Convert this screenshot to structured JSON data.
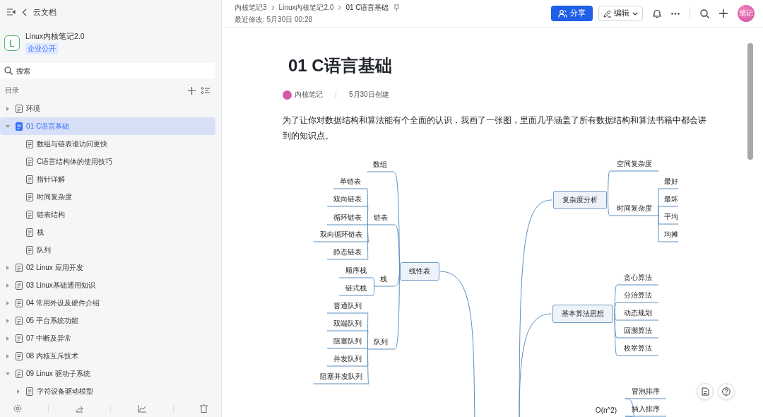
{
  "sidebar": {
    "back_label": "云文档",
    "space": {
      "name": "Linux内核笔记2.0",
      "tag": "企业公开",
      "logo": "L"
    },
    "search": {
      "placeholder": "搜索"
    },
    "toc_label": "目录",
    "items": [
      {
        "label": "环境",
        "expanded": false,
        "selected": false
      },
      {
        "label": "01 C语言基础",
        "expanded": true,
        "selected": true,
        "children": [
          {
            "label": "数组与链表谁访问更快",
            "selected": false
          },
          {
            "label": "C语言结构体的使用技巧",
            "selected": false
          },
          {
            "label": "指针详解",
            "selected": false
          },
          {
            "label": "时间复杂度",
            "selected": false
          },
          {
            "label": "链表结构",
            "selected": false
          },
          {
            "label": "栈",
            "selected": false
          },
          {
            "label": "队列",
            "selected": false
          }
        ]
      },
      {
        "label": "02 Linux 应用开发",
        "expanded": false,
        "selected": false
      },
      {
        "label": "03 Linux基础通用知识",
        "expanded": false,
        "selected": false
      },
      {
        "label": "04 常用外设及硬件介绍",
        "expanded": false,
        "selected": false
      },
      {
        "label": "05 平台系统功能",
        "expanded": false,
        "selected": false
      },
      {
        "label": "07 中断及异常",
        "expanded": false,
        "selected": false
      },
      {
        "label": "08 内核互斥技术",
        "expanded": false,
        "selected": false
      },
      {
        "label": "09 Linux 驱动子系统",
        "expanded": true,
        "selected": false,
        "children": [
          {
            "label": "字符设备驱动模型",
            "expanded": false,
            "selected": false
          }
        ]
      }
    ]
  },
  "header": {
    "breadcrumbs": [
      "内核笔记3",
      "Linux内核笔记2.0",
      "01 C语言基础"
    ],
    "last_modified": "最近修改: 5月30日 00:28",
    "share_button": "分享",
    "edit_button": "编辑",
    "avatar": "笔记"
  },
  "document": {
    "title": "01 C语言基础",
    "author": "内核笔记",
    "created": "5月30日创建",
    "paragraph": "为了让你对数据结构和算法能有个全面的认识，我画了一张图，里面几乎涵盖了所有数据结构和算法书籍中都会讲到的知识点。",
    "mind_map": [
      {
        "label": "线性表",
        "children": [
          {
            "label": "数组"
          },
          {
            "label": "链表",
            "children": [
              {
                "label": "单链表"
              },
              {
                "label": "双向链表"
              },
              {
                "label": "循环链表"
              },
              {
                "label": "双向循环链表"
              },
              {
                "label": "静态链表"
              }
            ]
          },
          {
            "label": "栈",
            "children": [
              {
                "label": "顺序栈"
              },
              {
                "label": "链式栈"
              }
            ]
          },
          {
            "label": "队列",
            "children": [
              {
                "label": "普通队列"
              },
              {
                "label": "双端队列"
              },
              {
                "label": "阻塞队列"
              },
              {
                "label": "并发队列"
              },
              {
                "label": "阻塞并发队列"
              }
            ]
          }
        ]
      },
      {
        "label": "复杂度分析",
        "children": [
          {
            "label": "空间复杂度"
          },
          {
            "label": "时间复杂度",
            "children": [
              {
                "label": "最好"
              },
              {
                "label": "最坏"
              },
              {
                "label": "平均"
              },
              {
                "label": "均摊"
              }
            ]
          }
        ]
      },
      {
        "label": "基本算法思想",
        "children": [
          {
            "label": "贪心算法"
          },
          {
            "label": "分治算法"
          },
          {
            "label": "动态规划"
          },
          {
            "label": "回溯算法"
          },
          {
            "label": "枚举算法"
          }
        ]
      },
      {
        "label": "O(n^2)",
        "children": [
          {
            "label": "冒泡排序"
          },
          {
            "label": "插入排序"
          }
        ]
      }
    ]
  }
}
